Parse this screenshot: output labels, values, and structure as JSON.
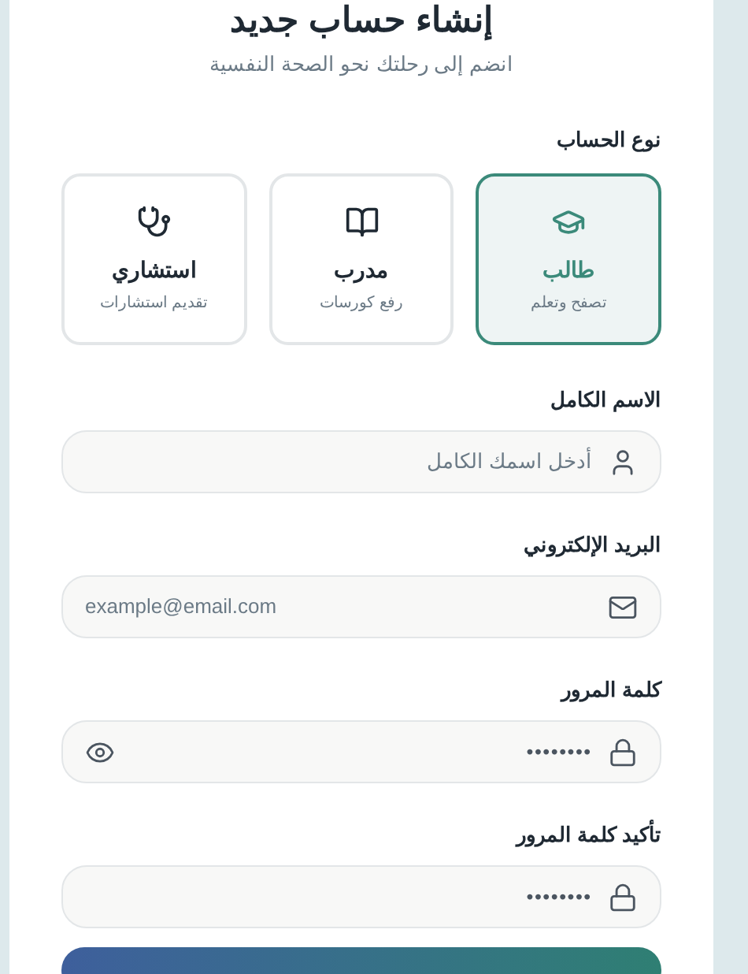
{
  "title": "إنشاء حساب جديد",
  "subtitle": "انضم إلى رحلتك نحو الصحة النفسية",
  "account_type": {
    "label": "نوع الحساب",
    "options": [
      {
        "kind": "student",
        "title": "طالب",
        "caption": "تصفح وتعلم",
        "selected": true
      },
      {
        "kind": "trainer",
        "title": "مدرب",
        "caption": "رفع كورسات",
        "selected": false
      },
      {
        "kind": "consultant",
        "title": "استشاري",
        "caption": "تقديم استشارات",
        "selected": false
      }
    ]
  },
  "fields": [
    {
      "kind": "name",
      "label": "الاسم الكامل",
      "placeholder": "أدخل اسمك الكامل",
      "reveal_toggle": false
    },
    {
      "kind": "email",
      "label": "البريد الإلكتروني",
      "placeholder": "example@email.com",
      "reveal_toggle": false
    },
    {
      "kind": "password",
      "label": "كلمة المرور",
      "value": "••••••••",
      "reveal_toggle": true
    },
    {
      "kind": "password",
      "label": "تأكيد كلمة المرور",
      "value": "••••••••",
      "reveal_toggle": false
    }
  ]
}
